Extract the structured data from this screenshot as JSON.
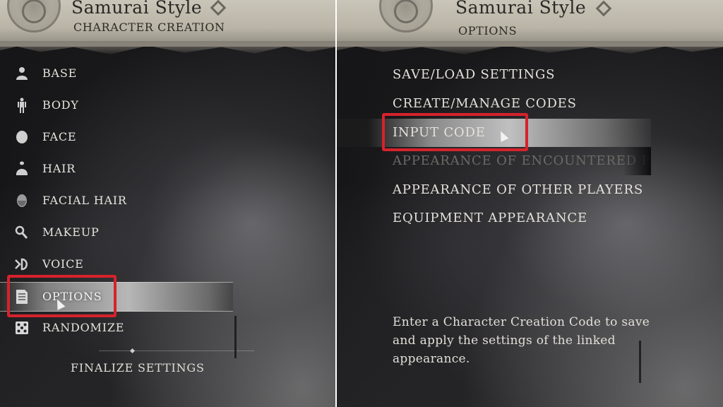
{
  "left_panel": {
    "game_title": "Samurai Style",
    "subtitle": "CHARACTER CREATION",
    "menu": [
      {
        "label": "BASE",
        "icon": "bust-icon"
      },
      {
        "label": "BODY",
        "icon": "body-figure-icon"
      },
      {
        "label": "FACE",
        "icon": "face-icon"
      },
      {
        "label": "HAIR",
        "icon": "hair-icon"
      },
      {
        "label": "FACIAL HAIR",
        "icon": "facial-hair-icon"
      },
      {
        "label": "MAKEUP",
        "icon": "makeup-brush-icon"
      },
      {
        "label": "VOICE",
        "icon": "voice-icon"
      },
      {
        "label": "OPTIONS",
        "icon": "document-icon",
        "selected": true
      },
      {
        "label": "RANDOMIZE",
        "icon": "dice-icon"
      }
    ],
    "finalize_label": "FINALIZE SETTINGS"
  },
  "right_panel": {
    "game_title": "Samurai Style",
    "subtitle": "OPTIONS",
    "options": [
      {
        "label": "SAVE/LOAD SETTINGS"
      },
      {
        "label": "CREATE/MANAGE CODES"
      },
      {
        "label": "INPUT CODE",
        "selected": true
      },
      {
        "label": "APPEARANCE OF ENCOUNTERED PLAY",
        "disabled": true
      },
      {
        "label": "APPEARANCE OF OTHER PLAYERS"
      },
      {
        "label": "EQUIPMENT APPEARANCE"
      }
    ],
    "description": "Enter a Character Creation Code to save and apply the settings of the linked appearance."
  },
  "colors": {
    "highlight": "#d6222b",
    "header": "#c9c5b8",
    "text": "#e6e3dc",
    "disabled_text": "#6b6a66"
  }
}
